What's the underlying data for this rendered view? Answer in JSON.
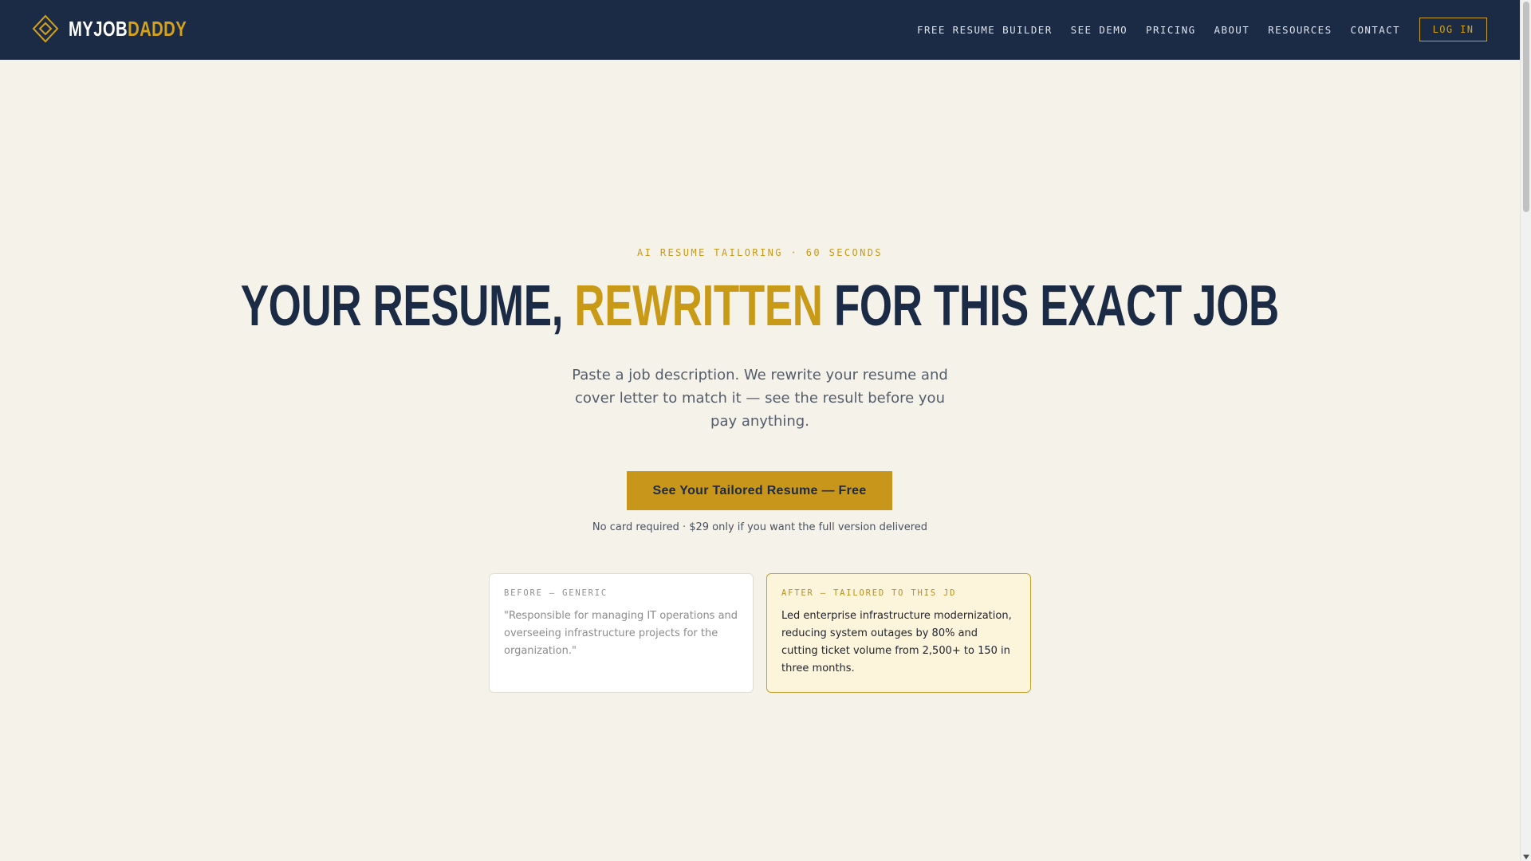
{
  "brand": {
    "name_part1": "MYJOB",
    "name_part2": "DADDY",
    "accent_color": "#d4a21a",
    "navy_color": "#1c2b45",
    "logo_icon": "diamond-logo-icon"
  },
  "nav": {
    "items": [
      {
        "label": "FREE RESUME BUILDER"
      },
      {
        "label": "SEE DEMO"
      },
      {
        "label": "PRICING"
      },
      {
        "label": "ABOUT"
      },
      {
        "label": "RESOURCES"
      },
      {
        "label": "CONTACT"
      }
    ],
    "login_label": "LOG IN"
  },
  "hero": {
    "eyebrow": "AI RESUME TAILORING · 60 SECONDS",
    "headline_part1": "YOUR RESUME, ",
    "headline_highlight": "REWRITTEN",
    "headline_part2": " FOR THIS EXACT JOB",
    "subtext": "Paste a job description. We rewrite your resume and cover letter to match it — see the result before you pay anything.",
    "cta_label": "See Your Tailored Resume — Free",
    "cta_note": "No card required · $29 only if you want the full version delivered"
  },
  "comparison": {
    "before": {
      "label": "BEFORE — GENERIC",
      "text": "\"Responsible for managing IT operations and overseeing infrastructure projects for the organization.\""
    },
    "after": {
      "label": "AFTER — TAILORED TO THIS JD",
      "text": "Led enterprise infrastructure modernization, reducing system outages by 80% and cutting ticket volume from 2,500+ to 150 in three months."
    }
  }
}
